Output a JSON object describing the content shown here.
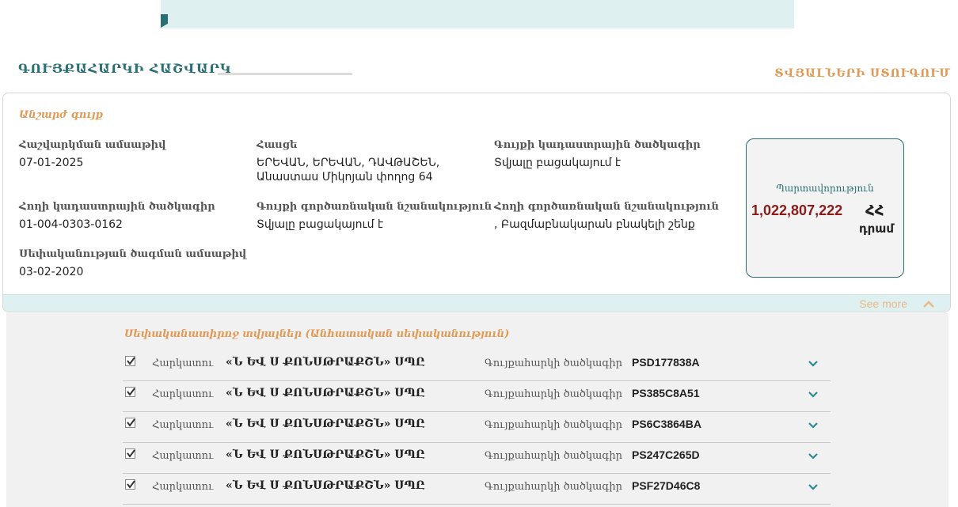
{
  "header": {
    "title": "ԳՈՒՅՔԱՀԱՐԿԻ ՀԱՇՎԱՐԿ",
    "data_search": "ՏՎՅԱԼՆԵՐԻ ՍՏՈՒԳՈՒՄ"
  },
  "property": {
    "subtitle": "Անշարժ գույք",
    "fields": [
      {
        "label": "Հաշվարկման ամսաթիվ",
        "value": "07-01-2025"
      },
      {
        "label": "Հասցե",
        "value": "ԵՐԵՎԱՆ, ԵՐԵՎԱՆ, ԴԱՎԹԱՇԵՆ,\nԱնաստաս Միկոյան փողոց 64"
      },
      {
        "label": "Գույքի կադաստրային ծածկագիր",
        "value": "Տվյալը բացակայում է"
      },
      {
        "label": "Հողի կադաստրային ծածկագիր",
        "value": "01-004-0303-0162"
      },
      {
        "label": "Գույքի գործառնական նշանակություն",
        "value": "Տվյալը բացակայում է"
      },
      {
        "label": "Հողի գործառնական նշանակություն",
        "value": ", Բազմաբնակարան բնակելի շենք"
      },
      {
        "label": "Սեփականության ծագման ամսաթիվ",
        "value": "03-02-2020"
      }
    ],
    "obligation": {
      "label": "Պարտավորություն",
      "amount": "1,022,807,222",
      "currency": "ՀՀ",
      "unit": "դրամ"
    },
    "see_more": "See more"
  },
  "owners": {
    "title": "Սեփականատիրոջ տվյալներ (Անհատական սեփականություն)",
    "payer_label": "Հարկատու",
    "code_label": "Գույքահարկի ծածկագիր",
    "rows": [
      {
        "owner": "«Ն ԵՎ Ս ՔՈՆՍԹՐԱՔՇՆ» ՍՊԸ",
        "code": "PSD177838A",
        "checked": true
      },
      {
        "owner": "«Ն ԵՎ Ս ՔՈՆՍԹՐԱՔՇՆ» ՍՊԸ",
        "code": "PS385C8A51",
        "checked": true
      },
      {
        "owner": "«Ն ԵՎ Ս ՔՈՆՍԹՐԱՔՇՆ» ՍՊԸ",
        "code": "PS6C3864BA",
        "checked": true
      },
      {
        "owner": "«Ն ԵՎ Ս ՔՈՆՍԹՐԱՔՇՆ» ՍՊԸ",
        "code": "PS247C265D",
        "checked": true
      },
      {
        "owner": "«Ն ԵՎ Ս ՔՈՆՍԹՐԱՔՇՆ» ՍՊԸ",
        "code": "PSF27D46C8",
        "checked": true
      }
    ]
  },
  "colors": {
    "teal": "#2a6f73",
    "orange": "#e09a55",
    "amount": "#8b1a1a"
  }
}
